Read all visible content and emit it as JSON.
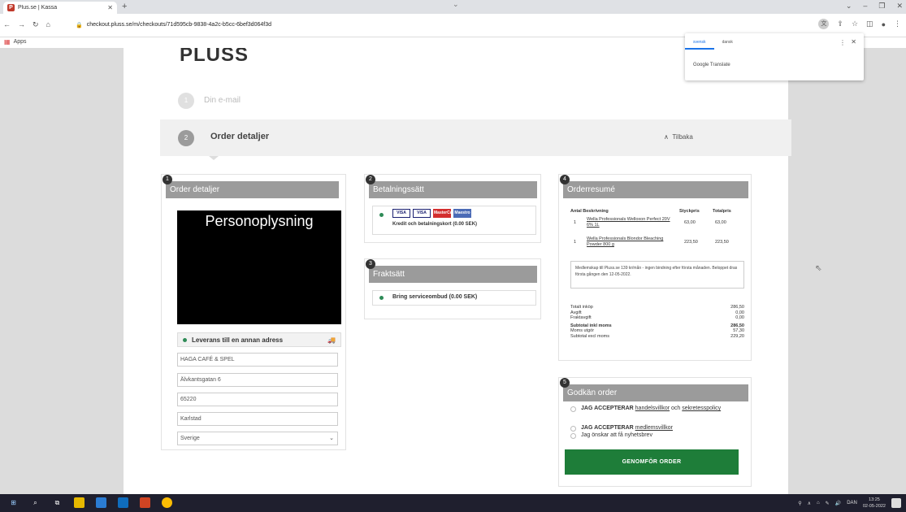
{
  "browser": {
    "tab_title": "Plus.se | Kassa",
    "tab_favicon": "P",
    "url": "checkout.pluss.se/m/checkouts/71d595cb-9838-4a2c-b5cc-6bef3d064f3d",
    "bookmarks_apps": "Apps"
  },
  "page": {
    "logo": "PLUSS",
    "step1": {
      "num": "1",
      "label": "Din e-mail"
    },
    "step2": {
      "num": "2",
      "label": "Order detaljer",
      "back": "Tilbaka"
    }
  },
  "details_panel": {
    "num": "1",
    "title": "Order detaljer",
    "redaction_label": "Personoplysning",
    "ship_alt_label": "Leverans till en annan adress",
    "fields": {
      "name": "HAGA CAFÉ & SPEL",
      "street": "Älvkantsgatan 6",
      "zip": "65220",
      "city": "Karlstad",
      "country": "Sverige"
    }
  },
  "payment_panel": {
    "num": "2",
    "title": "Betalningssätt",
    "cards": [
      "VISA",
      "VISA",
      "MasterCard",
      "Maestro"
    ],
    "option_label": "Kredit och betalningskort (0.00 SEK)"
  },
  "freight_panel": {
    "num": "3",
    "title": "Fraktsätt",
    "option_label": "Bring serviceombud (0.00 SEK)"
  },
  "summary_panel": {
    "num": "4",
    "title": "Orderresumé",
    "headers": {
      "qty_desc": "Antal Beskrivning",
      "unit": "Styckpris",
      "total": "Totalpris"
    },
    "rows": [
      {
        "qty": "1",
        "desc": "Wella Professionals Welloxon Perfect 20V 6% 1L",
        "unit": "63,00",
        "total": "63,00"
      },
      {
        "qty": "1",
        "desc": "Wella Professionals Blondor Bleaching Powder 800 g",
        "unit": "223,50",
        "total": "223,50"
      }
    ],
    "member_note": "Medlemskap till Pluss.se 139 kr/mån - ingen bindning efter första månaden. Beloppet dras första gången den 12-05-2022.",
    "sums": [
      {
        "label": "Totalt inköp",
        "value": "286,50",
        "bold": false
      },
      {
        "label": "Avgift",
        "value": "0,00",
        "bold": false
      },
      {
        "label": "Fraktavgift",
        "value": "0,00",
        "bold": false
      },
      {
        "label": "Subtotal inkl moms",
        "value": "286,50",
        "bold": true
      },
      {
        "label": "Moms utgör",
        "value": "57,30",
        "bold": false
      },
      {
        "label": "Subtotal excl moms",
        "value": "229,20",
        "bold": false
      }
    ]
  },
  "approve_panel": {
    "num": "5",
    "title": "Godkän order",
    "accept1_bold": "JAG ACCEPTERAR",
    "accept1_link": "handelsvillkor",
    "accept1_mid": "och",
    "accept1_link2": "sekretesspolicy",
    "accept2_bold": "JAG ACCEPTERAR",
    "accept2_link": "medlemsvillkor",
    "accept3": "Jag önskar att få nyhetsbrev",
    "confirm_button": "GENOMFÖR ORDER"
  },
  "translate_popup": {
    "tab_active": "svensk",
    "tab_other": "dansk",
    "label": "Google Translate",
    "accent": "#1a73e8"
  },
  "taskbar": {
    "lang": "DAN",
    "time": "13:25",
    "date": "02-05-2022"
  },
  "colors": {
    "confirm_green": "#1e7d39",
    "panel_header_gray": "#9b9b9b",
    "selected_dot": "#2e8b57"
  }
}
